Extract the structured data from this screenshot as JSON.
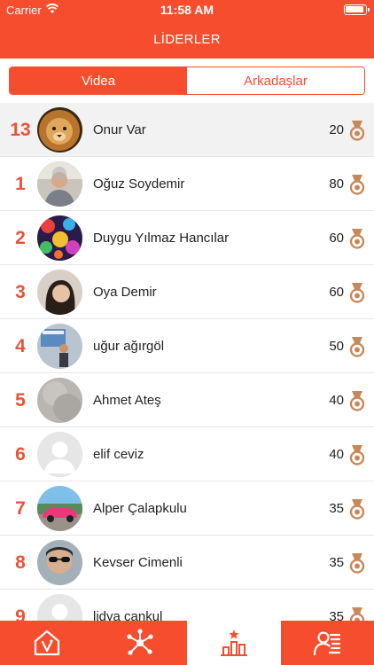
{
  "status": {
    "carrier": "Carrier",
    "time": "11:58 AM"
  },
  "header": {
    "title": "LİDERLER"
  },
  "segments": [
    {
      "label": "Videa",
      "active": true
    },
    {
      "label": "Arkadaşlar",
      "active": false
    }
  ],
  "rows": [
    {
      "rank": "13",
      "name": "Onur Var",
      "score": "20",
      "avatar": "lion-photo",
      "highlight": true
    },
    {
      "rank": "1",
      "name": "Oğuz Soydemir",
      "score": "80",
      "avatar": "man-photo"
    },
    {
      "rank": "2",
      "name": "Duygu Yılmaz Hancılar",
      "score": "60",
      "avatar": "colorful-pattern"
    },
    {
      "rank": "3",
      "name": "Oya Demir",
      "score": "60",
      "avatar": "woman-photo"
    },
    {
      "rank": "4",
      "name": "uğur  ağırgöl",
      "score": "50",
      "avatar": "presenter-photo"
    },
    {
      "rank": "5",
      "name": "Ahmet Ateş",
      "score": "40",
      "avatar": "gray-photo"
    },
    {
      "rank": "6",
      "name": "elif ceviz",
      "score": "40",
      "avatar": "default-avatar"
    },
    {
      "rank": "7",
      "name": "Alper Çalapkulu",
      "score": "35",
      "avatar": "pink-car-photo"
    },
    {
      "rank": "8",
      "name": "Kevser Cimenli",
      "score": "35",
      "avatar": "sunglasses-photo"
    },
    {
      "rank": "9",
      "name": "lidya cankul",
      "score": "35",
      "avatar": "default-avatar"
    }
  ],
  "tabs": [
    {
      "icon": "home-video-icon",
      "active": false
    },
    {
      "icon": "network-icon",
      "active": false
    },
    {
      "icon": "leaderboard-icon",
      "active": true
    },
    {
      "icon": "profile-list-icon",
      "active": false
    }
  ],
  "colors": {
    "accent": "#f54d2d",
    "rank": "#e8533a",
    "medal": "#c8895a"
  }
}
